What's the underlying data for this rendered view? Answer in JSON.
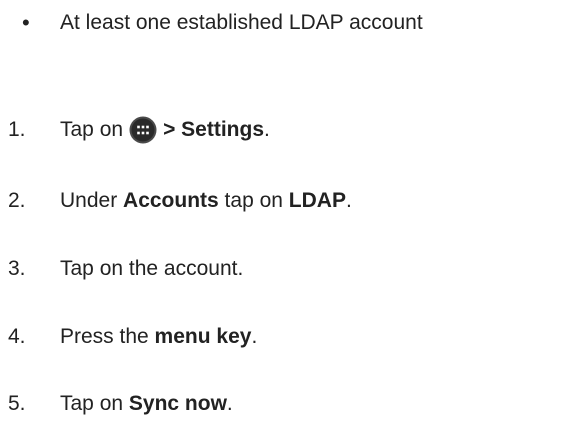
{
  "prerequisite": {
    "bullet": "•",
    "text": "At least one established LDAP account"
  },
  "steps": [
    {
      "number": "1.",
      "pre": "Tap on",
      "icon": "apps-launcher-icon",
      "bold": "> Settings",
      "post": "."
    },
    {
      "number": "2.",
      "pre": "Under ",
      "bold1": "Accounts",
      "mid": " tap on ",
      "bold2": "LDAP",
      "post": "."
    },
    {
      "number": "3.",
      "text": "Tap on the account."
    },
    {
      "number": "4.",
      "pre": "Press the ",
      "bold": "menu key",
      "post": "."
    },
    {
      "number": "5.",
      "pre": "Tap on ",
      "bold": "Sync now",
      "post": "."
    }
  ]
}
